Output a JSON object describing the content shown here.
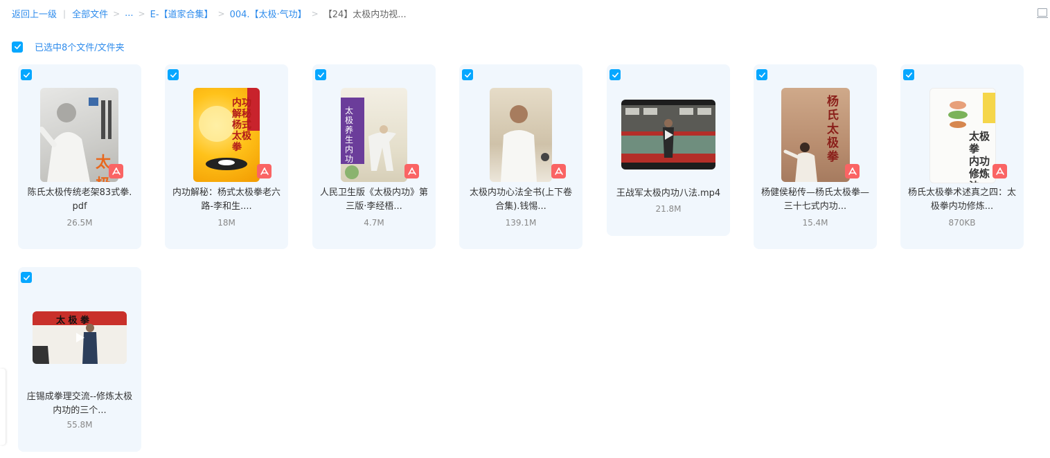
{
  "breadcrumb": {
    "back": "返回上一级",
    "all_files": "全部文件",
    "ellipsis": "...",
    "level1": "E-【道家合集】",
    "level2": "004.【太极·气功】",
    "current": "【24】太极内功视..."
  },
  "selection": {
    "text": "已选中8个文件/文件夹"
  },
  "files": [
    {
      "name_line1": "陈氏太极传统老架83式拳.",
      "name_line2": "pdf",
      "size": "26.5M",
      "type": "pdf",
      "cover_text": "太极"
    },
    {
      "name_line1": "内功解秘：杨式太极拳老六",
      "name_line2": "路-李和生....",
      "size": "18M",
      "type": "pdf",
      "cover_text": "内功解秘 杨式太极拳"
    },
    {
      "name_line1": "人民卫生版《太极内功》第",
      "name_line2": "三版·李经梧...",
      "size": "4.7M",
      "type": "pdf",
      "cover_text": "太极养生内功"
    },
    {
      "name_line1": "太极内功心法全书(上下卷",
      "name_line2": "合集).钱惕...",
      "size": "139.1M",
      "type": "pdf",
      "cover_text": ""
    },
    {
      "name_line1": "王战军太极内功八法.mp4",
      "name_line2": "",
      "size": "21.8M",
      "type": "video",
      "cover_text": ""
    },
    {
      "name_line1": "杨健侯秘传—杨氏太极拳—",
      "name_line2": "三十七式内功...",
      "size": "15.4M",
      "type": "pdf",
      "cover_text": "杨氏太极拳"
    },
    {
      "name_line1": "杨氏太极拳术述真之四：太",
      "name_line2": "极拳内功修炼...",
      "size": "870KB",
      "type": "pdf",
      "cover_text": "太极拳 内功修炼法"
    },
    {
      "name_line1": "庄锡成拳理交流--修炼太极",
      "name_line2": "内功的三个...",
      "size": "55.8M",
      "type": "video",
      "cover_text": "太 极 拳"
    }
  ]
}
